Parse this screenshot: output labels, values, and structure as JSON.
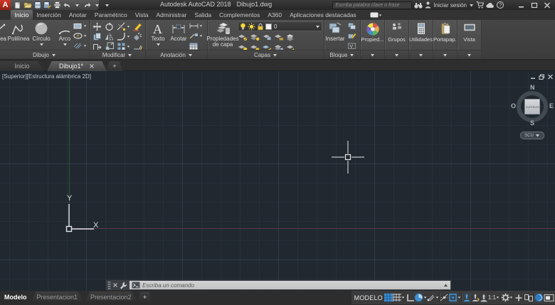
{
  "titlebar": {
    "logo": "A",
    "app_title": "Autodesk AutoCAD 2018",
    "doc_title": "Dibujo1.dwg",
    "search_placeholder": "Escriba palabra clave o frase",
    "signin_label": "Iniciar sesión",
    "qat_icons": [
      "new-file-icon",
      "open-file-icon",
      "save-icon",
      "save-as-icon",
      "plot-icon",
      "undo-icon",
      "redo-icon",
      "qat-menu-caret-icon"
    ]
  },
  "ribbon": {
    "tabs": [
      {
        "label": "Inicio",
        "active": true
      },
      {
        "label": "Inserción",
        "active": false
      },
      {
        "label": "Anotar",
        "active": false
      },
      {
        "label": "Paramétrico",
        "active": false
      },
      {
        "label": "Vista",
        "active": false
      },
      {
        "label": "Administrar",
        "active": false
      },
      {
        "label": "Salida",
        "active": false
      },
      {
        "label": "Complementos",
        "active": false
      },
      {
        "label": "A360",
        "active": false
      },
      {
        "label": "Aplicaciones destacadas",
        "active": false
      }
    ],
    "panels": {
      "dibujo": {
        "label": "Dibujo",
        "linea": "Línea",
        "polilinea": "Polilínea",
        "circulo": "Círculo",
        "arco": "Arco"
      },
      "modificar": {
        "label": "Modificar"
      },
      "anotacion": {
        "label": "Anotación",
        "texto": "Texto",
        "acotar": "Acotar"
      },
      "capas": {
        "label": "Capas",
        "propiedades_line1": "Propiedades",
        "propiedades_line2": "de capa",
        "current_layer": "0"
      },
      "bloque": {
        "label": "Bloque",
        "insertar": "Insertar"
      },
      "collapsed": [
        {
          "label": "Propied...",
          "icon": "properties-wheel-icon"
        },
        {
          "label": "Grupos",
          "icon": "groups-icon"
        },
        {
          "label": "Utilidades",
          "icon": "utilities-calculator-icon"
        },
        {
          "label": "Portapap...",
          "icon": "clipboard-icon"
        },
        {
          "label": "Vista",
          "icon": "view-panel-icon"
        }
      ]
    }
  },
  "doc_tabs": {
    "inicio": "Inicio",
    "active_doc": "Dibujo1*",
    "new_tab": "+"
  },
  "viewport": {
    "control_view": "[Superior]",
    "control_style": "[Estructura alámbrica 2D]",
    "viewcube": {
      "n": "N",
      "s": "S",
      "e": "E",
      "o": "O",
      "center": "SUPERIOR",
      "ucs_button": "SCU"
    },
    "ucs_axis_x": "X",
    "ucs_axis_y": "Y"
  },
  "command_line": {
    "prompt_placeholder": "Escriba un comando"
  },
  "statusbar": {
    "layout_tabs": {
      "modelo": "Modelo",
      "pres1": "Presentacion1",
      "pres2": "Presentacion2",
      "new": "+"
    },
    "model_label": "MODELO",
    "annotation_scale": "1:1",
    "icons": [
      "grid-display-icon",
      "snap-mode-icon",
      "ortho-icon",
      "polar-tracking-icon",
      "isodraft-icon",
      "object-snap-tracking-icon",
      "object-snap-icon",
      "annotation-visibility-icon",
      "annotation-autoscale-icon",
      "annotation-scale-icon",
      "workspace-gear-icon",
      "customization-plus-icon",
      "isolate-objects-icon",
      "graphics-performance-icon",
      "clean-screen-icon"
    ]
  },
  "colors": {
    "accent_blue": "#3f8fd2",
    "accent_yellow": "#e9c63f",
    "viewport_bg": "#212830",
    "axis_green": "#2f5c33",
    "axis_red": "#55333a"
  }
}
